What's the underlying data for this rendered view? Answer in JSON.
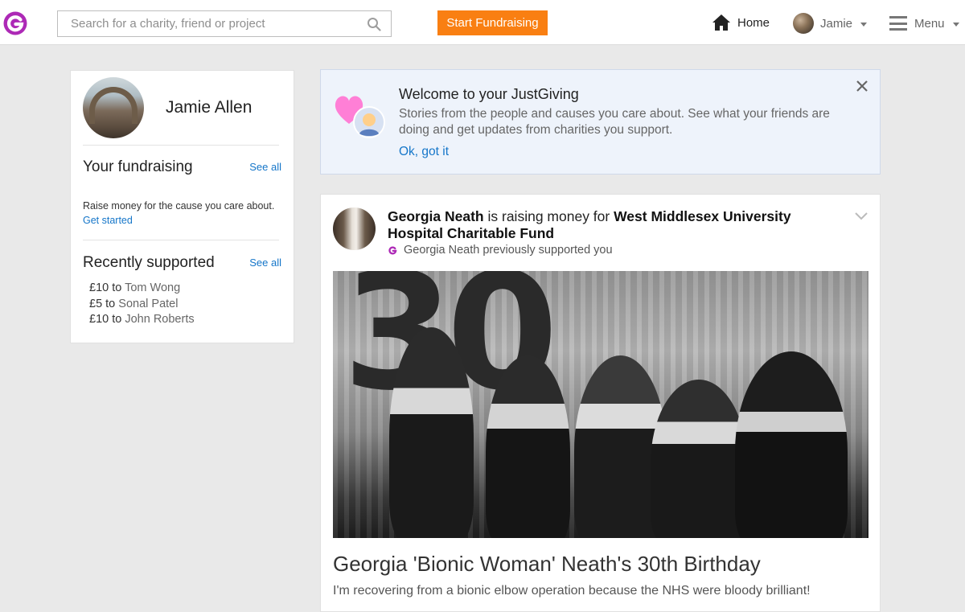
{
  "header": {
    "logo_icon": "justgiving-logo-icon",
    "search": {
      "placeholder": "Search for a charity, friend or project",
      "value": ""
    },
    "start_fundraising_label": "Start Fundraising",
    "home_label": "Home",
    "user_label": "Jamie",
    "menu_label": "Menu",
    "colors": {
      "brand": "#ad29b6",
      "cta": "#f97f12",
      "link": "#1576c9"
    }
  },
  "profile": {
    "name": "Jamie Allen",
    "fundraising": {
      "title": "Your fundraising",
      "see_all": "See all",
      "text": "Raise money for the cause you care about.",
      "cta": "Get started"
    },
    "recently_supported": {
      "title": "Recently supported",
      "see_all": "See all",
      "items": [
        {
          "amount": "£10 to",
          "who": "Tom Wong"
        },
        {
          "amount": "£5 to",
          "who": "Sonal Patel"
        },
        {
          "amount": "£10 to",
          "who": "John Roberts"
        }
      ]
    }
  },
  "welcome": {
    "title": "Welcome to your JustGiving",
    "text": "Stories from the people and causes you care about. See what your friends are doing and get updates from charities you support.",
    "ok": "Ok, got it"
  },
  "post": {
    "author": "Georgia Neath",
    "action": "is raising money for",
    "cause": "West Middlesex University Hospital Charitable Fund",
    "sub": "Georgia Neath previously supported you",
    "photo_text": "30",
    "title": "Georgia 'Bionic Woman' Neath's 30th Birthday",
    "body": "I'm recovering from a bionic elbow operation because the NHS were bloody brilliant!"
  }
}
